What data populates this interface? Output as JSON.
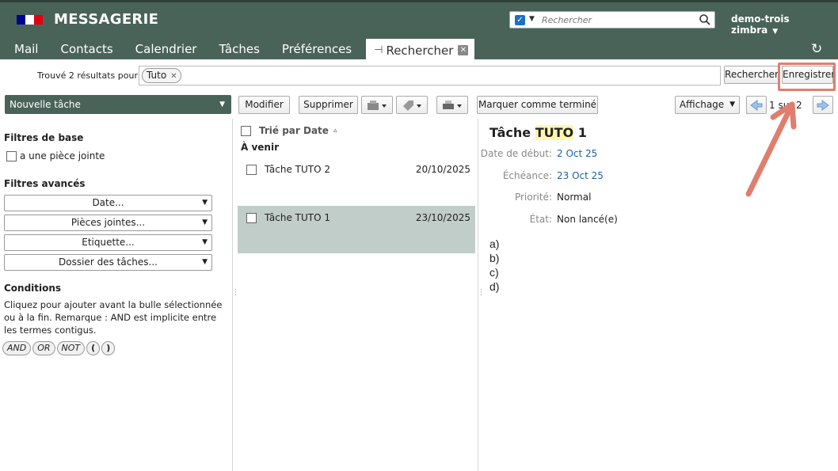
{
  "app": {
    "title": "MESSAGERIE",
    "flag_colors": [
      "#000091",
      "#ffffff",
      "#e1000f"
    ]
  },
  "search": {
    "placeholder": "Rechercher"
  },
  "user": {
    "name": "demo-trois zimbra"
  },
  "tabs": [
    "Mail",
    "Contacts",
    "Calendrier",
    "Tâches",
    "Préférences"
  ],
  "active_tab": {
    "label": "Rechercher"
  },
  "results": {
    "found_label": "Trouvé 2 résultats pour :",
    "query_bubble": "Tuto",
    "search_button": "Rechercher",
    "save_button": "Enregistrer"
  },
  "toolbar": {
    "new_task": "Nouvelle tâche",
    "edit": "Modifier",
    "delete": "Supprimer",
    "mark_done": "Marquer comme terminé",
    "view": "Affichage",
    "page_info": "1 sur 2"
  },
  "filters": {
    "basic_title": "Filtres de base",
    "attachment": "a une pièce jointe",
    "advanced_title": "Filtres avancés",
    "selects": [
      "Date...",
      "Pièces jointes...",
      "Etiquette...",
      "Dossier des tâches..."
    ],
    "conditions_title": "Conditions",
    "conditions_text": "Cliquez pour ajouter avant la bulle sélectionnée ou à la fin. Remarque : AND est implicite entre les termes contigus.",
    "operators": [
      "AND",
      "OR",
      "NOT",
      "(",
      ")"
    ]
  },
  "list": {
    "sort_label": "Trié par Date",
    "group_label": "À venir",
    "rows": [
      {
        "name": "Tâche TUTO 2",
        "date": "20/10/2025",
        "selected": false
      },
      {
        "name": "Tâche TUTO 1",
        "date": "23/10/2025",
        "selected": true
      }
    ]
  },
  "detail": {
    "title_prefix": "Tâche ",
    "title_highlight": "TUTO",
    "title_suffix": " 1",
    "fields": [
      {
        "label": "Date de début:",
        "value": "2 Oct 25",
        "link": true
      },
      {
        "label": "Échéance:",
        "value": "23 Oct 25",
        "link": true
      },
      {
        "label": "Priorité:",
        "value": "Normal",
        "link": false
      },
      {
        "label": "État:",
        "value": "Non lancé(e)",
        "link": false
      }
    ],
    "body_lines": [
      "a)",
      "b)",
      "c)",
      "d)"
    ]
  },
  "colors": {
    "header": "#4a6359",
    "selected_row": "#c1cdc8",
    "annotation": "#e07e6e",
    "link": "#1e5fa5"
  }
}
